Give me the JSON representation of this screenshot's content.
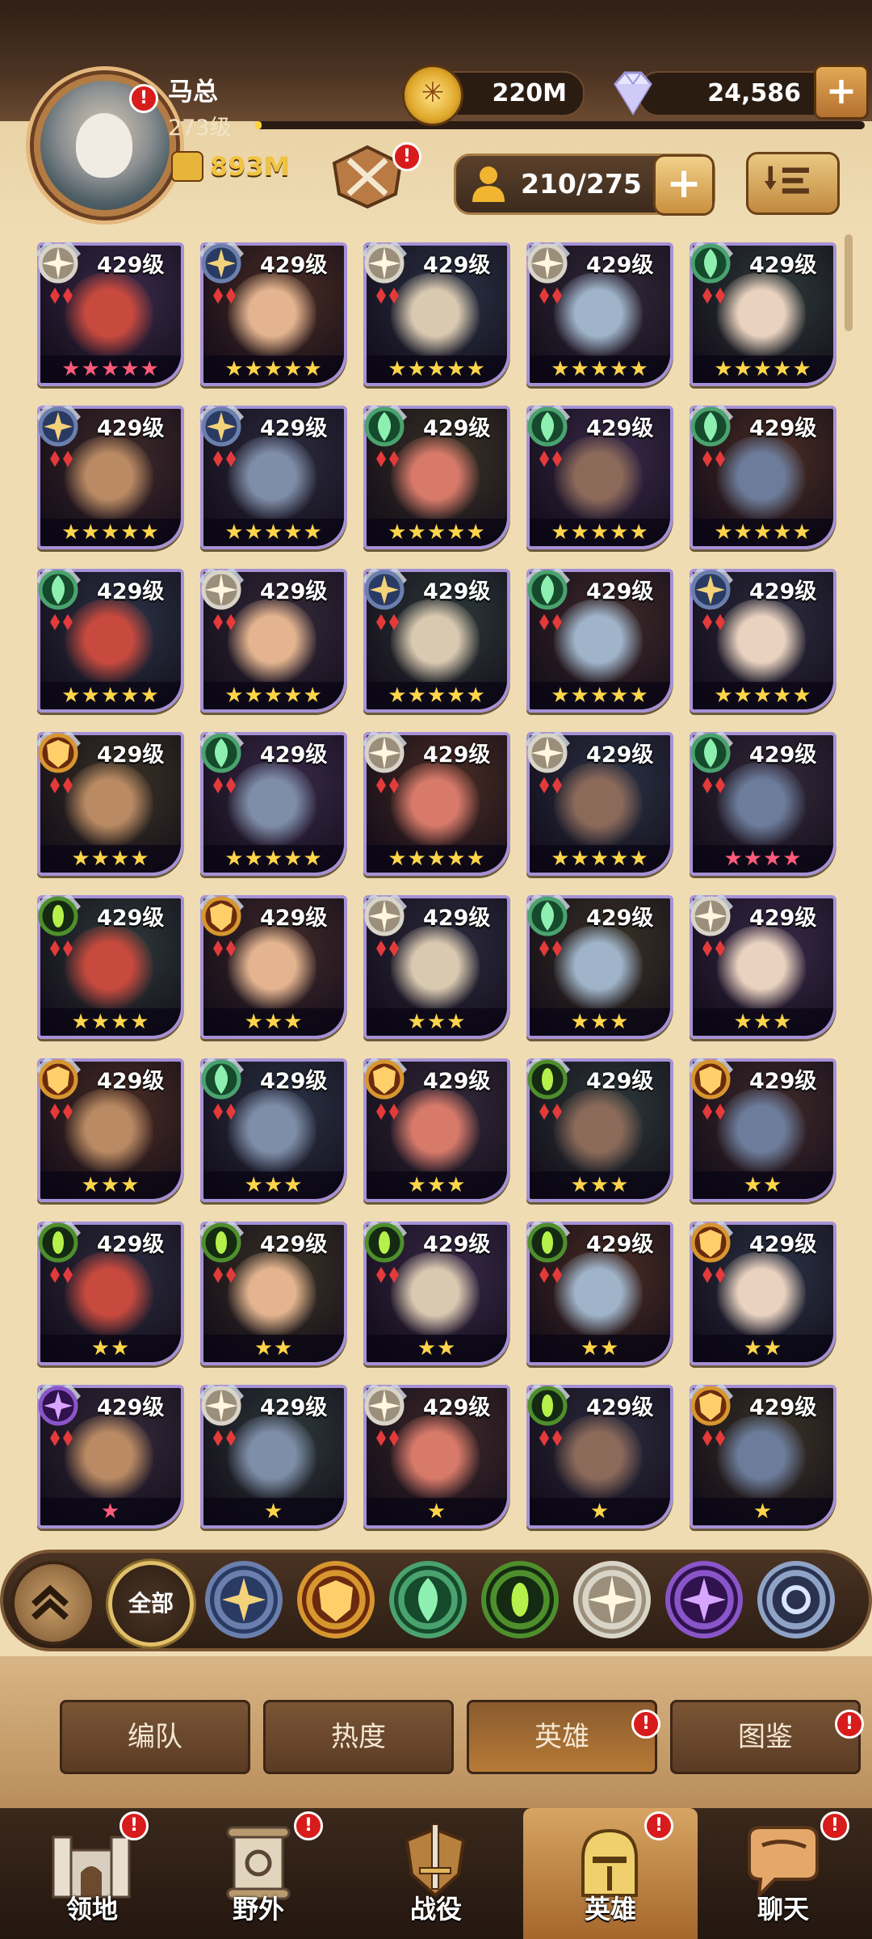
{
  "player": {
    "name": "马总",
    "level": "273级",
    "power": "893M",
    "xp_progress": 0.01
  },
  "resources": {
    "gold": "220M",
    "diamonds": "24,586"
  },
  "hero_slots": {
    "text": "210/275"
  },
  "hero_grid": {
    "level_label": "429级",
    "rows": [
      [
        {
          "faction": "celestial",
          "stars": "★★★★★",
          "star_color": "#ff5a7a"
        },
        {
          "faction": "lightbearer",
          "stars": "★★★★★",
          "star_color": "#ffd54a"
        },
        {
          "faction": "celestial",
          "stars": "★★★★★",
          "star_color": "#ffd54a"
        },
        {
          "faction": "celestial",
          "stars": "★★★★★",
          "star_color": "#ffd54a"
        },
        {
          "faction": "wilder",
          "stars": "★★★★★",
          "star_color": "#ffd54a"
        }
      ],
      [
        {
          "faction": "lightbearer",
          "stars": "★★★★★",
          "star_color": "#ffd54a"
        },
        {
          "faction": "lightbearer",
          "stars": "★★★★★",
          "star_color": "#ffd54a"
        },
        {
          "faction": "wilder",
          "stars": "★★★★★",
          "star_color": "#ffd54a"
        },
        {
          "faction": "wilder",
          "stars": "★★★★★",
          "star_color": "#ffd54a"
        },
        {
          "faction": "wilder",
          "stars": "★★★★★",
          "star_color": "#ffd54a"
        }
      ],
      [
        {
          "faction": "wilder",
          "stars": "★★★★★",
          "star_color": "#ffd54a"
        },
        {
          "faction": "celestial",
          "stars": "★★★★★",
          "star_color": "#ffd54a"
        },
        {
          "faction": "lightbearer",
          "stars": "★★★★★",
          "star_color": "#ffd54a"
        },
        {
          "faction": "wilder",
          "stars": "★★★★★",
          "star_color": "#ffd54a"
        },
        {
          "faction": "lightbearer",
          "stars": "★★★★★",
          "star_color": "#ffd54a"
        }
      ],
      [
        {
          "faction": "mauler",
          "stars": "★★★★",
          "star_color": "#ffd54a"
        },
        {
          "faction": "wilder",
          "stars": "★★★★★",
          "star_color": "#ffd54a"
        },
        {
          "faction": "celestial",
          "stars": "★★★★★",
          "star_color": "#ffd54a"
        },
        {
          "faction": "celestial",
          "stars": "★★★★★",
          "star_color": "#ffd54a"
        },
        {
          "faction": "wilder",
          "stars": "★★★★",
          "star_color": "#ff5a7a"
        }
      ],
      [
        {
          "faction": "graveborn",
          "stars": "★★★★",
          "star_color": "#ffd54a"
        },
        {
          "faction": "mauler",
          "stars": "★★★",
          "star_color": "#ffd54a"
        },
        {
          "faction": "celestial",
          "stars": "★★★",
          "star_color": "#ffd54a"
        },
        {
          "faction": "wilder",
          "stars": "★★★",
          "star_color": "#ffd54a"
        },
        {
          "faction": "celestial",
          "stars": "★★★",
          "star_color": "#ffd54a"
        }
      ],
      [
        {
          "faction": "mauler",
          "stars": "★★★",
          "star_color": "#ffd54a"
        },
        {
          "faction": "wilder",
          "stars": "★★★",
          "star_color": "#ffd54a"
        },
        {
          "faction": "mauler",
          "stars": "★★★",
          "star_color": "#ffd54a"
        },
        {
          "faction": "graveborn",
          "stars": "★★★",
          "star_color": "#ffd54a"
        },
        {
          "faction": "mauler",
          "stars": "★★",
          "star_color": "#ffd54a"
        }
      ],
      [
        {
          "faction": "graveborn",
          "stars": "★★",
          "star_color": "#ffd54a"
        },
        {
          "faction": "graveborn",
          "stars": "★★",
          "star_color": "#ffd54a"
        },
        {
          "faction": "graveborn",
          "stars": "★★",
          "star_color": "#ffd54a"
        },
        {
          "faction": "graveborn",
          "stars": "★★",
          "star_color": "#ffd54a"
        },
        {
          "faction": "mauler",
          "stars": "★★",
          "star_color": "#ffd54a"
        }
      ],
      [
        {
          "faction": "hypogean",
          "stars": "★",
          "star_color": "#ff5a7a"
        },
        {
          "faction": "celestial",
          "stars": "★",
          "star_color": "#ffd54a"
        },
        {
          "faction": "celestial",
          "stars": "★",
          "star_color": "#ffd54a"
        },
        {
          "faction": "graveborn",
          "stars": "★",
          "star_color": "#ffd54a"
        },
        {
          "faction": "mauler",
          "stars": "★",
          "star_color": "#ffd54a"
        }
      ]
    ]
  },
  "filters": {
    "all_label": "全部",
    "icons": [
      "lightbearer-faction-icon",
      "mauler-faction-icon",
      "wilder-faction-icon",
      "graveborn-faction-icon",
      "celestial-faction-icon",
      "hypogean-faction-icon",
      "dimensional-faction-icon"
    ]
  },
  "tabs": [
    {
      "label": "编队"
    },
    {
      "label": "热度"
    },
    {
      "label": "英雄"
    },
    {
      "label": "图鉴"
    }
  ],
  "nav": [
    {
      "label": "领地"
    },
    {
      "label": "野外"
    },
    {
      "label": "战役"
    },
    {
      "label": "英雄"
    },
    {
      "label": "聊天"
    }
  ],
  "notification_mark": "!",
  "colors": {
    "accent_gold": "#ffd54a",
    "frame_purple": "#a691d6",
    "alert_red": "#d81c1c"
  }
}
